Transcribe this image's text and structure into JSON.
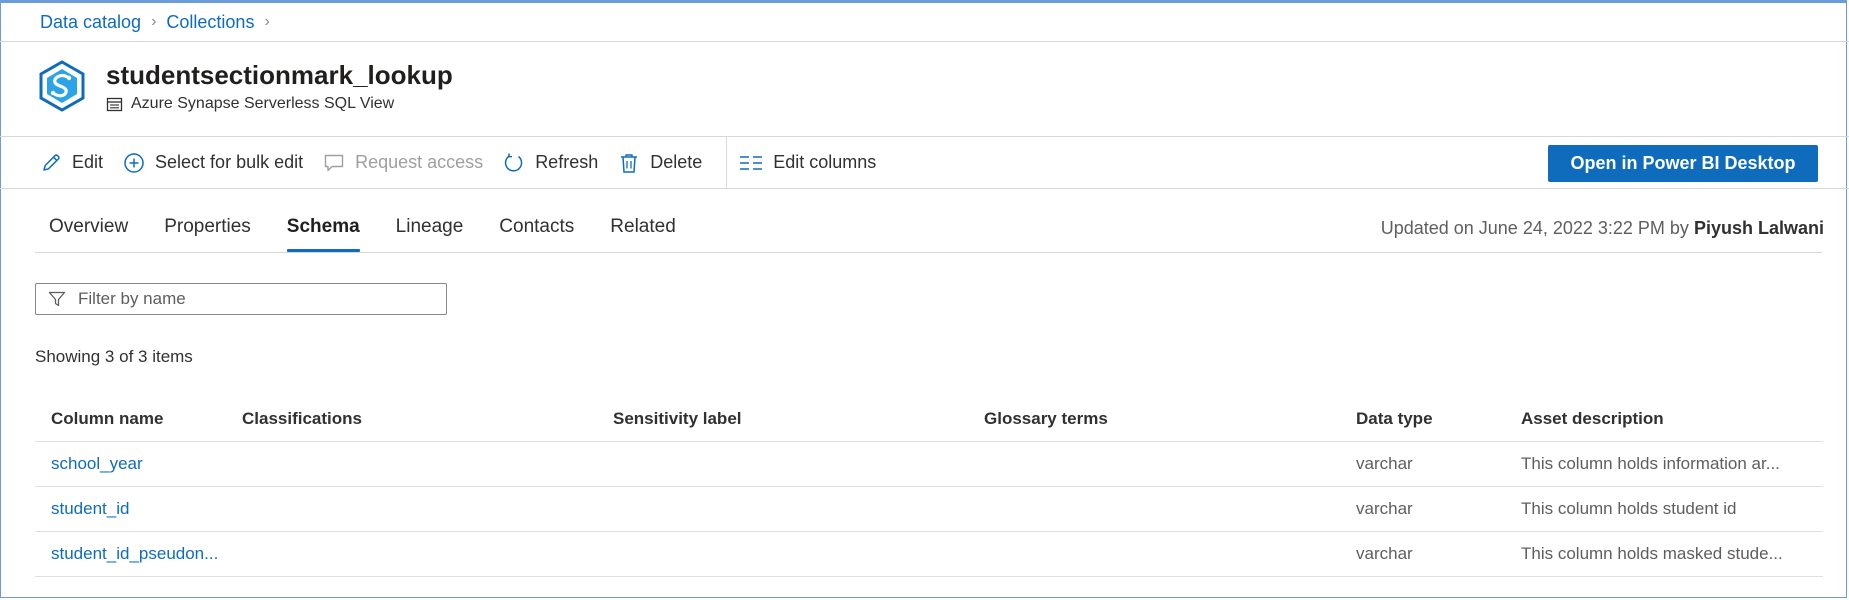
{
  "breadcrumb": {
    "items": [
      "Data catalog",
      "Collections"
    ]
  },
  "asset": {
    "title": "studentsectionmark_lookup",
    "type": "Azure Synapse Serverless SQL View",
    "logo_icon": "azure-synapse-icon",
    "type_icon": "sql-view-icon"
  },
  "toolbar": {
    "edit": "Edit",
    "bulk_edit": "Select for bulk edit",
    "request_access": "Request access",
    "refresh": "Refresh",
    "delete": "Delete",
    "edit_columns": "Edit columns",
    "open_powerbi": "Open in Power BI Desktop"
  },
  "tabs": [
    "Overview",
    "Properties",
    "Schema",
    "Lineage",
    "Contacts",
    "Related"
  ],
  "active_tab": "Schema",
  "updated": {
    "prefix": "Updated on June 24, 2022 3:22 PM by",
    "user": "Piyush Lalwani"
  },
  "filter": {
    "placeholder": "Filter by name",
    "value": ""
  },
  "showing": "Showing 3 of 3 items",
  "table": {
    "headers": [
      "Column name",
      "Classifications",
      "Sensitivity label",
      "Glossary terms",
      "Data type",
      "Asset description"
    ],
    "rows": [
      {
        "name": "school_year",
        "classifications": "",
        "sensitivity": "",
        "glossary": "",
        "type": "varchar",
        "description": "This column holds information ar..."
      },
      {
        "name": "student_id",
        "classifications": "",
        "sensitivity": "",
        "glossary": "",
        "type": "varchar",
        "description": "This column holds student id"
      },
      {
        "name": "student_id_pseudon...",
        "classifications": "",
        "sensitivity": "",
        "glossary": "",
        "type": "varchar",
        "description": "This column holds masked stude..."
      }
    ]
  },
  "colors": {
    "accent": "#0f6cbd",
    "text": "#323130",
    "muted": "#605e5c",
    "disabled": "#a19f9d"
  }
}
